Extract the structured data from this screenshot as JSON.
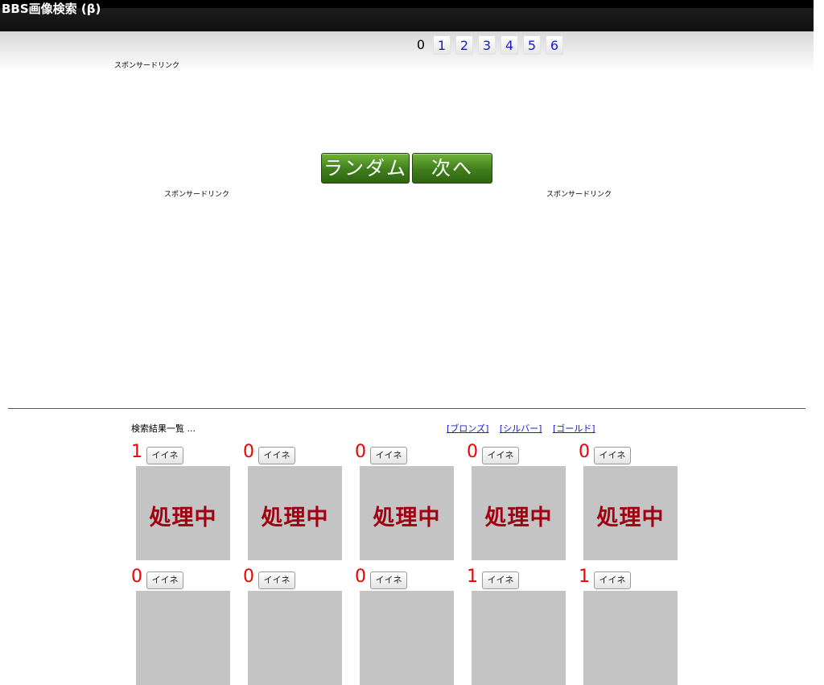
{
  "header": {
    "title": "BBS画像検索 (β)"
  },
  "pager": {
    "current": "0",
    "pages": [
      "1",
      "2",
      "3",
      "4",
      "5",
      "6"
    ]
  },
  "ads": {
    "sponsor_label": "スポンサードリンク"
  },
  "buttons": {
    "random": "ランダム",
    "next": "次へ >>"
  },
  "results": {
    "label": "検索結果一覧 ...",
    "rank_links": [
      "[ブロンズ]",
      "[シルバー]",
      "[ゴールド]"
    ],
    "like_label": "イイネ",
    "processing_label": "処理中",
    "items": [
      {
        "count": "1"
      },
      {
        "count": "0"
      },
      {
        "count": "0"
      },
      {
        "count": "0"
      },
      {
        "count": "0"
      },
      {
        "count": "0"
      },
      {
        "count": "0"
      },
      {
        "count": "0"
      },
      {
        "count": "1"
      },
      {
        "count": "1"
      }
    ]
  }
}
